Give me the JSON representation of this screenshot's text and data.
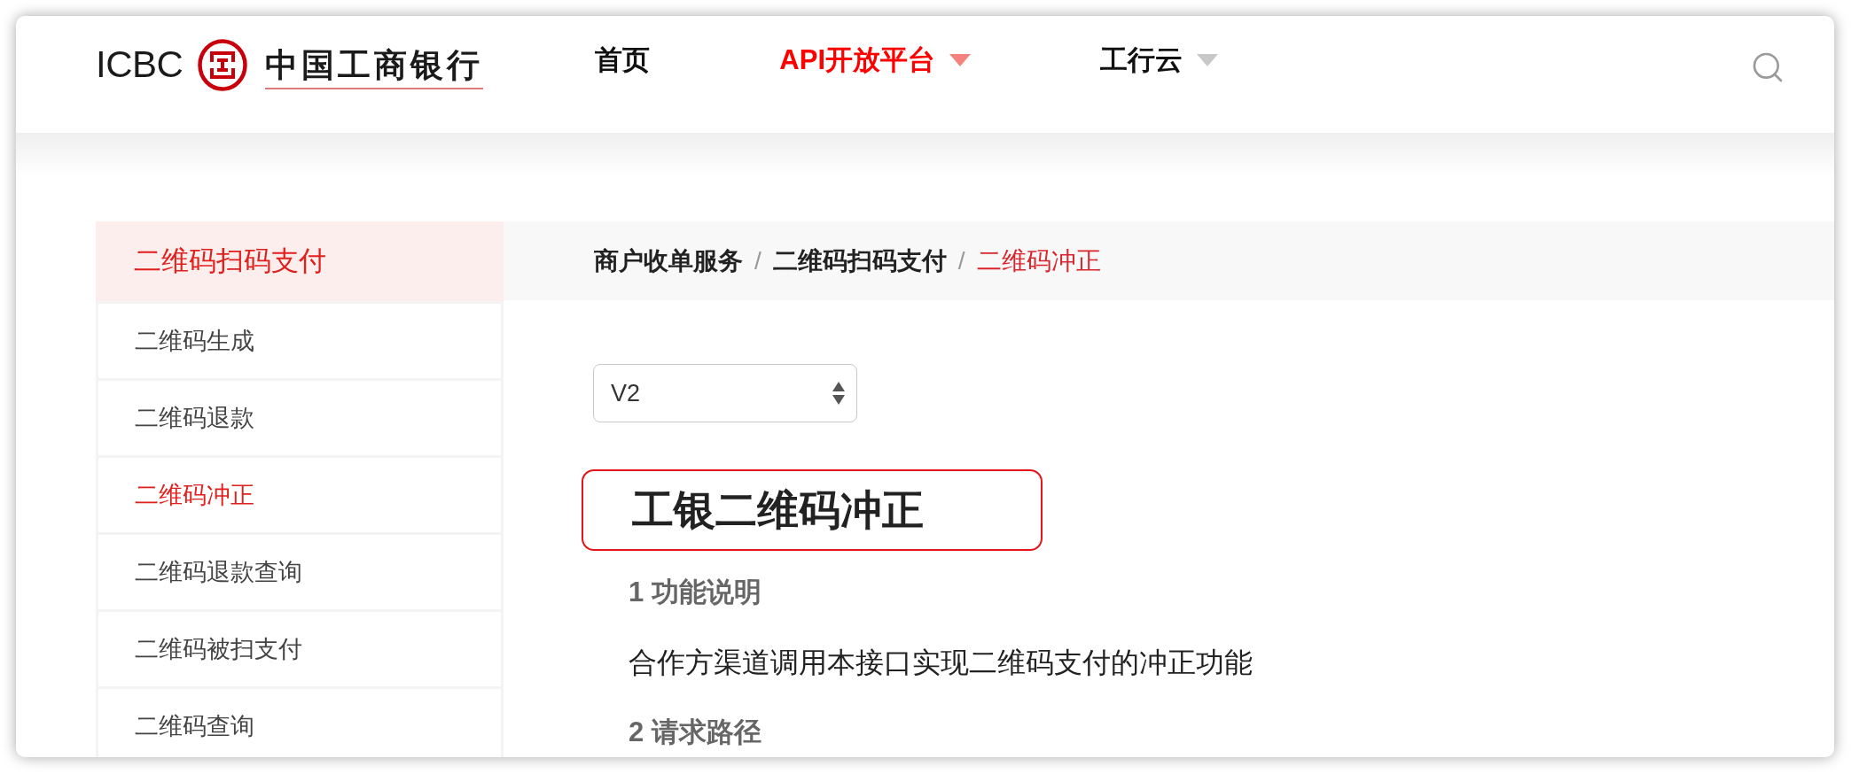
{
  "logo": {
    "latin": "ICBC",
    "chinese": "中国工商银行"
  },
  "nav": [
    {
      "label": "首页",
      "selected": false,
      "has_dropdown": false
    },
    {
      "label": "API开放平台",
      "selected": true,
      "has_dropdown": true
    },
    {
      "label": "工行云",
      "selected": false,
      "has_dropdown": true
    }
  ],
  "sidebar": {
    "title": "二维码扫码支付",
    "items": [
      {
        "label": "二维码生成",
        "selected": false
      },
      {
        "label": "二维码退款",
        "selected": false
      },
      {
        "label": "二维码冲正",
        "selected": true
      },
      {
        "label": "二维码退款查询",
        "selected": false
      },
      {
        "label": "二维码被扫支付",
        "selected": false
      },
      {
        "label": "二维码查询",
        "selected": false
      }
    ]
  },
  "breadcrumb": {
    "items": [
      {
        "label": "商户收单服务",
        "current": false
      },
      {
        "label": "二维码扫码支付",
        "current": false
      },
      {
        "label": "二维码冲正",
        "current": true
      }
    ],
    "separators": [
      "/",
      "/"
    ]
  },
  "version_select": {
    "value": "V2"
  },
  "title": {
    "text": "工银二维码冲正",
    "highlighted": true
  },
  "content": [
    {
      "kind": "heading",
      "text": "1 功能说明"
    },
    {
      "kind": "paragraph",
      "text": "合作方渠道调用本接口实现二维码支付的冲正功能"
    },
    {
      "kind": "heading",
      "text": "2 请求路径"
    }
  ]
}
